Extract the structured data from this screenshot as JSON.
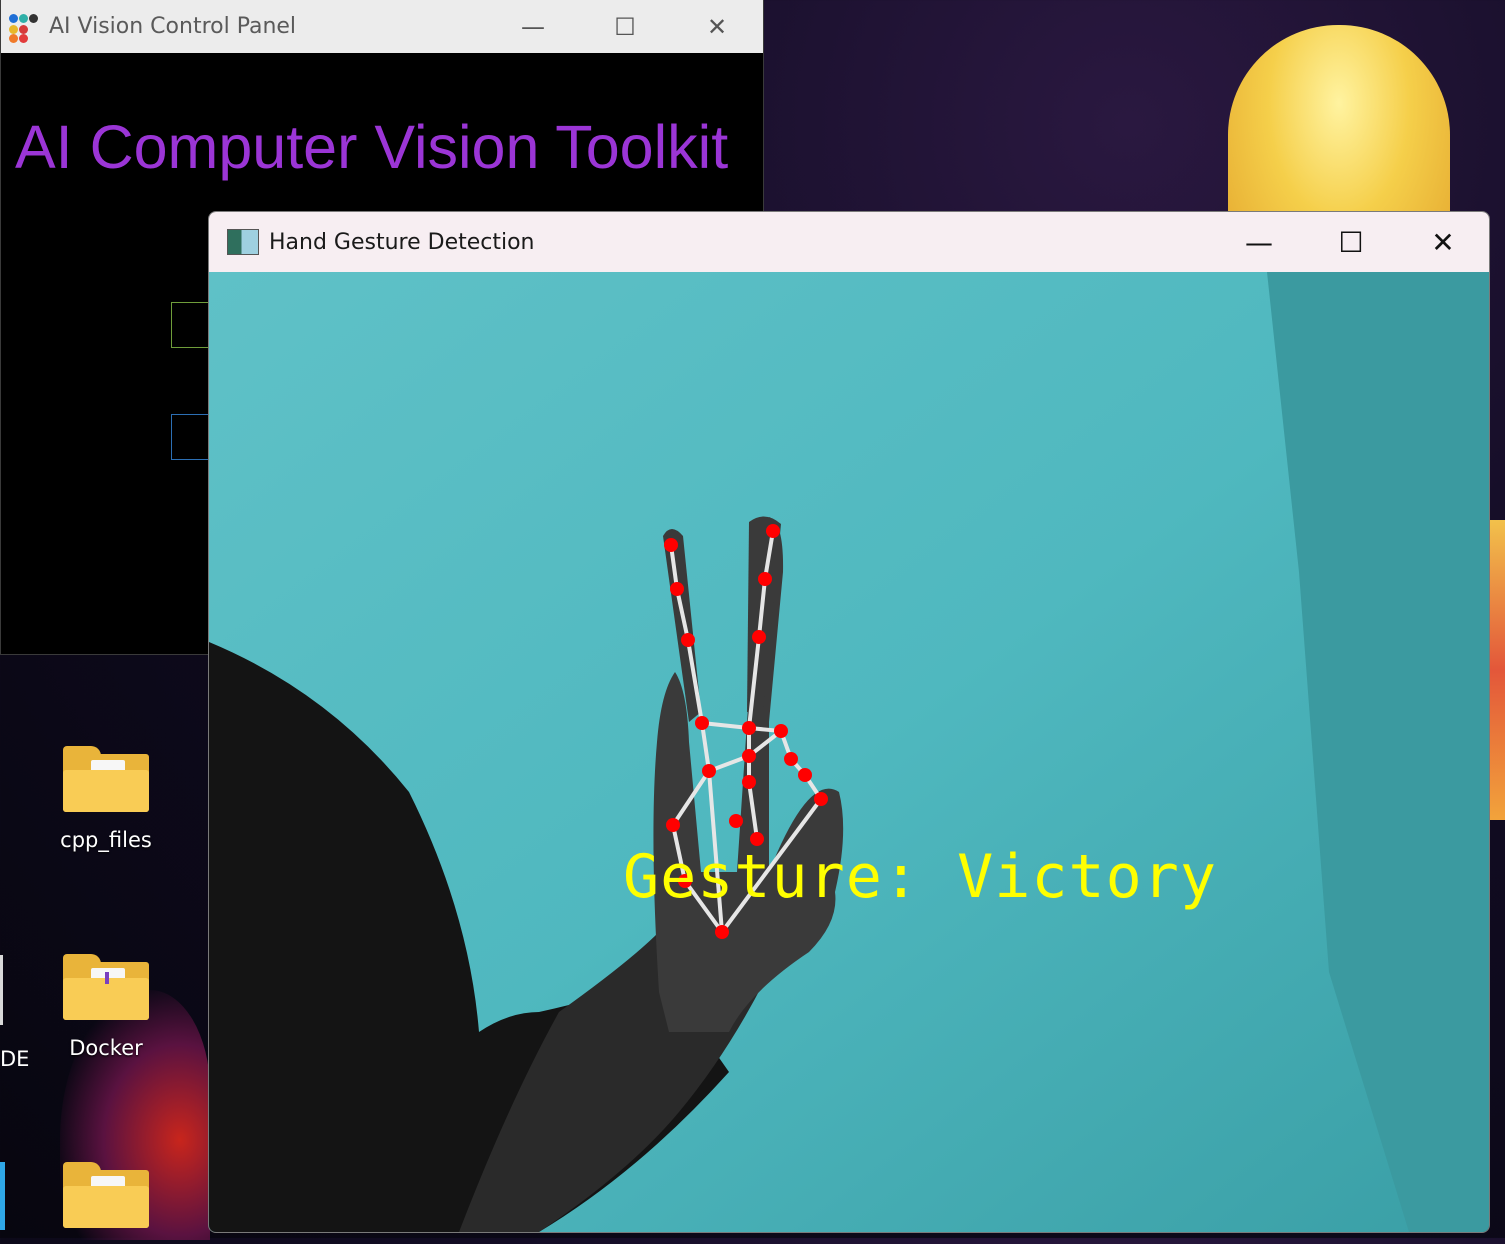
{
  "desktop": {
    "icons": [
      {
        "label": "cpp_files",
        "icon": "folder-icon"
      },
      {
        "label": "Docker",
        "icon": "folder-icon"
      },
      {
        "label": "",
        "icon": "folder-icon"
      }
    ],
    "partial_label": "DE"
  },
  "control_panel": {
    "title": "AI Vision Control Panel",
    "heading": "AI Computer Vision Toolkit",
    "heading_color": "#9b35d6",
    "controls": {
      "minimize": "—",
      "maximize": "☐",
      "close": "✕"
    }
  },
  "gesture_window": {
    "title": "Hand Gesture Detection",
    "overlay_text": "Gesture: Victory",
    "overlay_color": "#ffff00",
    "landmark_color": "#ff0000",
    "connection_color": "#e6e6e6",
    "wall_color": "#4fb8bf",
    "controls": {
      "minimize": "—",
      "maximize": "☐",
      "close": "✕"
    }
  }
}
